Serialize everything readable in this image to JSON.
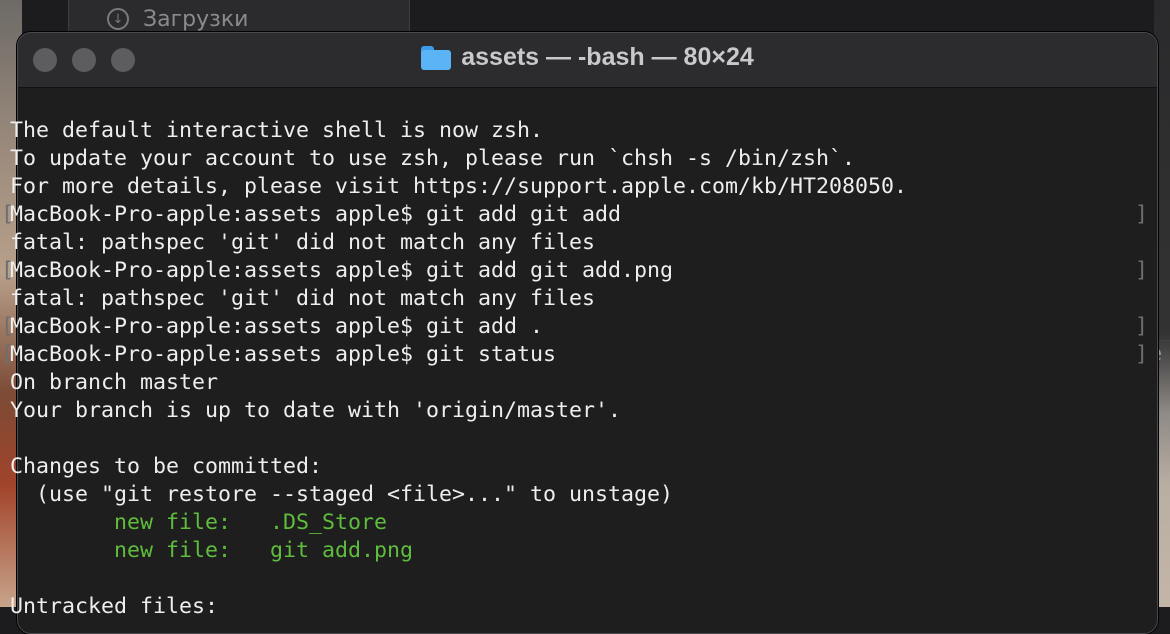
{
  "background_window": {
    "item_label": "Загрузки",
    "item_icon": "download-icon"
  },
  "background_right_glyph": "e",
  "window": {
    "title": "assets — -bash — 80×24",
    "title_icon": "folder-icon"
  },
  "terminal": {
    "lines": [
      "",
      "The default interactive shell is now zsh.",
      "To update your account to use zsh, please run `chsh -s /bin/zsh`.",
      "For more details, please visit https://support.apple.com/kb/HT208050.",
      "MacBook-Pro-apple:assets apple$ git add git add",
      "fatal: pathspec 'git' did not match any files",
      "MacBook-Pro-apple:assets apple$ git add git add.png",
      "fatal: pathspec 'git' did not match any files",
      "MacBook-Pro-apple:assets apple$ git add .",
      "MacBook-Pro-apple:assets apple$ git status",
      "On branch master",
      "Your branch is up to date with 'origin/master'.",
      "",
      "Changes to be committed:",
      "  (use \"git restore --staged <file>...\" to unstage)",
      "\tnew file:   .DS_Store",
      "\tnew file:   git add.png",
      "",
      "Untracked files:"
    ],
    "staged_color": "#5fbd3d",
    "text_color": "#eeeeee",
    "bracket_left": "[",
    "bracket_right": "]"
  }
}
